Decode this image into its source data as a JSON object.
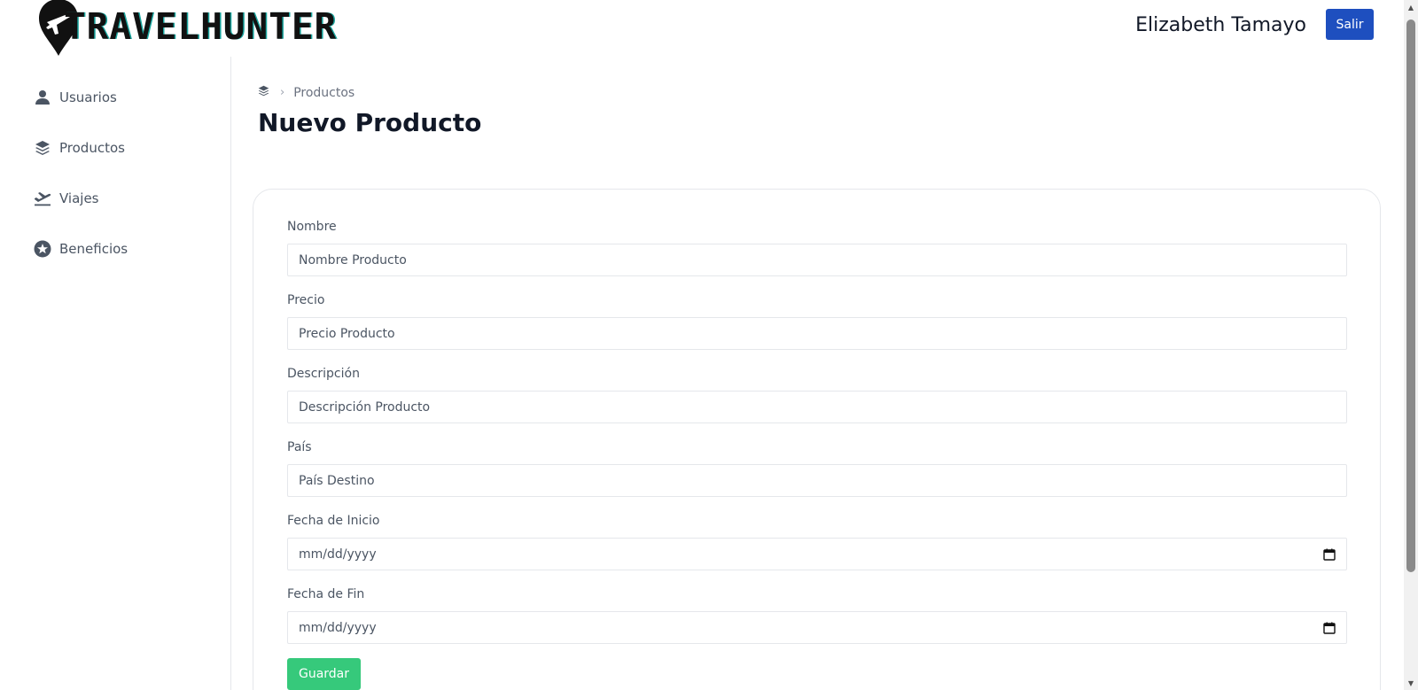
{
  "header": {
    "brand": "TRAVELHUNTER",
    "user_name": "Elizabeth Tamayo",
    "logout_label": "Salir"
  },
  "sidebar": {
    "items": [
      {
        "label": "Usuarios",
        "icon": "user-icon"
      },
      {
        "label": "Productos",
        "icon": "layers-icon"
      },
      {
        "label": "Viajes",
        "icon": "plane-departure-icon"
      },
      {
        "label": "Beneficios",
        "icon": "star-circle-icon"
      }
    ]
  },
  "breadcrumb": {
    "icon": "layers-icon",
    "current": "Productos"
  },
  "page": {
    "title": "Nuevo Producto"
  },
  "form": {
    "fields": [
      {
        "label": "Nombre",
        "placeholder": "Nombre Producto"
      },
      {
        "label": "Precio",
        "placeholder": "Precio Producto"
      },
      {
        "label": "Descripción",
        "placeholder": "Descripción Producto"
      },
      {
        "label": "País",
        "placeholder": "País Destino"
      },
      {
        "label": "Fecha de Inicio",
        "placeholder": "mm/dd/yyyy"
      },
      {
        "label": "Fecha de Fin",
        "placeholder": "mm/dd/yyyy"
      }
    ],
    "submit_label": "Guardar"
  },
  "colors": {
    "primary": "#1e4fbf",
    "success": "#36c97b",
    "logo_accent": "#1aa7a0"
  }
}
